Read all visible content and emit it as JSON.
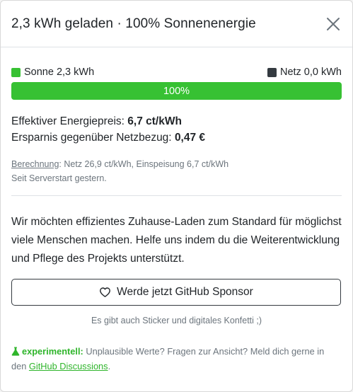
{
  "header": {
    "title": "2,3 kWh geladen · 100% Sonnenenergie"
  },
  "legend": {
    "sun_label": "Sonne 2,3 kWh",
    "grid_label": "Netz 0,0 kWh"
  },
  "progress": {
    "sun_percent": 100,
    "label": "100%"
  },
  "price": {
    "effective_label": "Effektiver Energiepreis:",
    "effective_value": "6,7 ct/kWh",
    "savings_label": "Ersparnis gegenüber Netzbezug:",
    "savings_value": "0,47 €"
  },
  "calculation": {
    "link_text": "Berechnung",
    "details": ": Netz 26,9 ct/kWh, Einspeisung 6,7 ct/kWh",
    "since": "Seit Serverstart gestern."
  },
  "appeal": {
    "text": "Wir möchten effizientes Zuhause-Laden zum Standard für möglichst viele Menschen machen. Helfe uns indem du die Weiterentwicklung und Pflege des Projekts unterstützt."
  },
  "sponsor": {
    "button_label": "Werde jetzt GitHub Sponsor",
    "sticker_note": "Es gibt auch Sticker und digitales Konfetti ;)"
  },
  "experimental": {
    "label": "experimentell:",
    "text": " Unplausible Werte? Fragen zur Ansicht? Meld dich gerne in den ",
    "link": "GitHub Discussions",
    "end": "."
  },
  "colors": {
    "sun": "#37c133",
    "grid": "#343a40",
    "accent": "#2fb52b"
  },
  "icons": {
    "close": "close-icon",
    "heart": "heart-icon",
    "flask": "flask-icon"
  }
}
